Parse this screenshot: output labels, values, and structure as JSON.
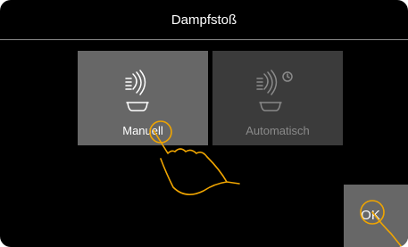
{
  "header": {
    "title": "Dampfstoß"
  },
  "options": [
    {
      "label": "Manuell",
      "icon": "steam-bowl-icon",
      "state": "selected"
    },
    {
      "label": "Automatisch",
      "icon": "steam-bowl-timer-icon",
      "state": "inactive"
    }
  ],
  "confirm": {
    "label": "OK"
  },
  "colors": {
    "background": "#000000",
    "tile_selected": "#676767",
    "tile_inactive": "#3b3b3b",
    "text": "#ffffff",
    "text_inactive": "#8a8a8a",
    "touch_highlight": "#f0a500"
  }
}
